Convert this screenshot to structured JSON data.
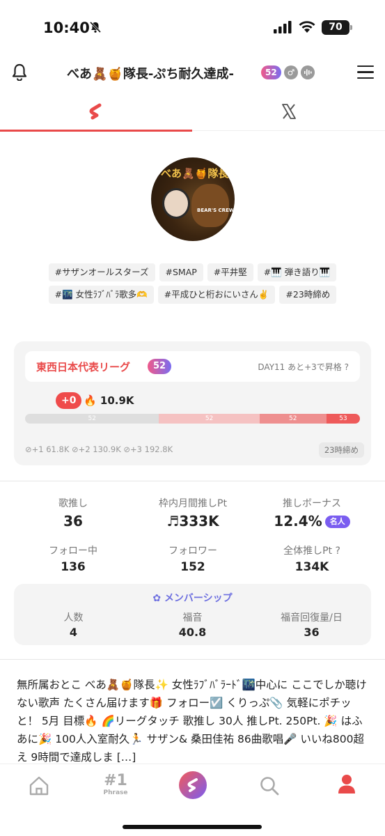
{
  "status_bar": {
    "time": "10:40",
    "battery": "70"
  },
  "header": {
    "title": "べあ🧸🍯隊長-ぷち耐久達成-",
    "level": "52",
    "gender": "♂"
  },
  "tabs": [
    {
      "name": "stand-fm"
    },
    {
      "name": "x"
    }
  ],
  "avatar": {
    "banner": "べあ🧸🍯隊長",
    "crew": "BEAR'S CREW"
  },
  "tags": [
    [
      "#サザンオールスターズ",
      "#SMAP",
      "#平井堅",
      "#🎹 弾き語り🎹"
    ],
    [
      "#🌃 女性ﾗﾌﾞﾊﾞﾗ歌多🫶",
      "#平成ひと桁おにいさん✌️",
      "#23時締め"
    ]
  ],
  "league": {
    "name": "東西日本代表リーグ",
    "badge": "52",
    "day_info": "DAY11 あと+3で昇格 ?",
    "rank_change": "+0",
    "score": "🔥 10.9K",
    "progress_level": 0.0,
    "segments": [
      {
        "label": "52",
        "share": 0.4,
        "color": "#dedede"
      },
      {
        "label": "52",
        "share": 0.3,
        "color": "#f5c2c2"
      },
      {
        "label": "52",
        "share": 0.2,
        "color": "#ee8f8f"
      },
      {
        "label": "53",
        "share": 0.1,
        "color": "#ee5a5a"
      }
    ],
    "thresholds": "⊘+1 61.8K  ⊘+2 130.9K  ⊘+3 192.8K",
    "deadline": "23時締め"
  },
  "stats": [
    {
      "label": "歌推し",
      "value": "36"
    },
    {
      "label": "枠内月間推しPt",
      "value": "♬333K"
    },
    {
      "label": "推しボーナス",
      "value": "12.4%",
      "badge": "名人"
    },
    {
      "label": "フォロー中",
      "value": "136"
    },
    {
      "label": "フォロワー",
      "value": "152"
    },
    {
      "label": "全体推しPt ?",
      "value": "134K"
    }
  ],
  "membership": {
    "title": "✿ メンバーシップ",
    "items": [
      {
        "label": "人数",
        "value": "4"
      },
      {
        "label": "福音",
        "value": "40.8"
      },
      {
        "label": "福音回復量/日",
        "value": "36"
      }
    ]
  },
  "bio": "無所属おとこ べあ🧸🍯隊長✨ 女性ﾗﾌﾞﾊﾞﾗｰﾄﾞ🌃中心に ここでしか聴けない歌声 たくさん届けます🎁 フォロー☑️ くりっぷ📎 気軽にポチッと！ 5月 目標🔥 🌈リーグタッチ 歌推し 30人 推しPt. 250Pt. 🎉 はふあに🎉 100人入室耐久🏃 サザン& 桑田佳祐 86曲歌唱🎤 いいね800超え 9時間で達成しま […]",
  "bottom_nav": {
    "phrase_num": "#1",
    "phrase_label": "Phrase"
  }
}
